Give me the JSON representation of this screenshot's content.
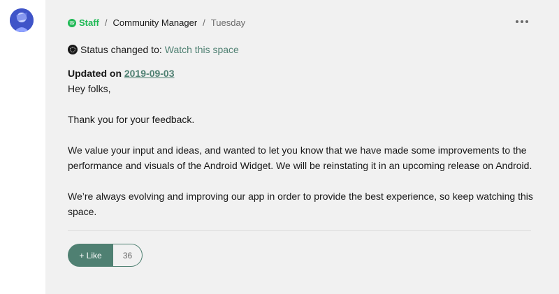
{
  "post": {
    "badge_label": "Staff",
    "role": "Community Manager",
    "separator": "/",
    "date": "Tuesday",
    "status_prefix": "Status changed to:",
    "status_value": "Watch this space",
    "updated_prefix": "Updated on",
    "updated_date": "2019-09-03",
    "paragraphs": [
      "Hey folks,",
      "Thank you for your feedback.",
      "We value your input and ideas, and wanted to let you know that we have made some improvements to the performance and visuals of the Android Widget. We will be reinstating it in an upcoming release on Android.",
      "We’re always evolving and improving our app in order to provide the best experience, so keep watching this space."
    ]
  },
  "actions": {
    "like_label": "+ Like",
    "like_count": "36"
  },
  "icons": {
    "badge": "spotify-icon",
    "status": "status-icon",
    "more": "more-options-icon"
  },
  "colors": {
    "accent": "#4f8072",
    "staff": "#1db954",
    "card_bg": "#f1f1f1"
  }
}
